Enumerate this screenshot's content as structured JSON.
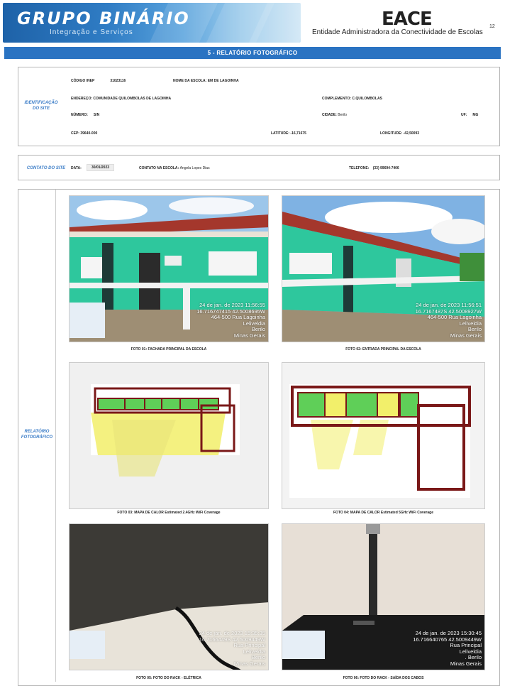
{
  "header": {
    "logo_title": "GRUPO BINÁRIO",
    "logo_subtitle": "Integração e Serviços",
    "org_short": "EACE",
    "org_full": "Entidade Administradora da Conectividade de Escolas",
    "page_number": "12"
  },
  "section_title": "5 - RELATÓRIO FOTOGRÁFICO",
  "identification": {
    "side_label": "IDENTIFICAÇÃO DO SITE",
    "inep_label": "CÓDIGO INEP",
    "inep_value": "31023116",
    "school_label": "NOME DA ESCOLA:",
    "school_value": "EM DE LAGOINHA",
    "address_label": "ENDEREÇO:",
    "address_value": "COMUNIDADE QUILOMBOLAS DE LAGOINHA",
    "complement_label": "COMPLEMENTO:",
    "complement_value": "C.QUILOMBOLAS",
    "number_label": "NÚMERO:",
    "number_value": "S/N",
    "city_label": "CIDADE:",
    "city_value": "Berilo",
    "uf_label": "UF:",
    "uf_value": "MG",
    "cep_label": "CEP:",
    "cep_value": "39640-000",
    "lat_label": "LATITUDE:",
    "lat_value": "-16,71675",
    "long_label": "LONGITUDE:",
    "long_value": "-42,50093"
  },
  "contact": {
    "side_label": "CONTATO DO SITE",
    "date_label": "DATA:",
    "date_value": "30/01/2023",
    "contact_label": "CONTATO NA ESCOLA:",
    "contact_value": "Angela Lopes Dias",
    "phone_label": "TELEFONE:",
    "phone_value": "(33) 99694-7406"
  },
  "report": {
    "side_label": "RELATÓRIO FOTOGRÁFICO",
    "photos": [
      {
        "caption": "FOTO 01: FACHADA PRINCIPAL DA ESCOLA",
        "overlay": [
          "24 de jan. de 2023 11:56:55",
          "16.716747415 42.5008695W",
          "464-500 Rua Lagoinha",
          "Leliveldia",
          "Berilo",
          "Minas Gerais"
        ]
      },
      {
        "caption": "FOTO 02: ENTRADA PRINCIPAL DA ESCOLA",
        "overlay": [
          "24 de jan. de 2023 11:56:51",
          "16.7167487S 42.5008927W",
          "464-500 Rua Lagoinha",
          "Leliveldia",
          "Berilo",
          "Minas Gerais"
        ]
      },
      {
        "caption": "FOTO 03: MAPA DE CALOR  Estimated 2.4GHz WiFi Coverage"
      },
      {
        "caption": "FOTO 04: MAPA DE CALOR  Estimated 5GHz WiFi Coverage"
      },
      {
        "caption": "FOTO 05: FOTO DO RACK - ELÉTRICA",
        "overlay": [
          "24 de jan. de 2023 15:35:35",
          "16.7166449S 42.5009449W",
          "Rua Principal",
          "Leliveldia",
          "Berilo",
          "Minas Gerais"
        ]
      },
      {
        "caption": "FOTO 06:  FOTO DO RACK - SAÍDA DOS CABOS",
        "overlay": [
          "24 de jan. de 2023 15:30:45",
          "16.716640765 42.5009449W",
          "Rua Principal",
          "Leliveldia",
          ". Berilo",
          "Minas Gerais"
        ]
      }
    ]
  },
  "colors": {
    "accent": "#2a73c2",
    "label_blue": "#3a7cc7"
  }
}
